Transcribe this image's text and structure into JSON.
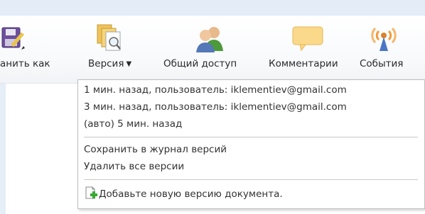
{
  "toolbar": {
    "buttons": [
      {
        "label": "анить как",
        "icon": "save-as-icon"
      },
      {
        "label": "Версия",
        "caret": "▼",
        "icon": "version-icon"
      },
      {
        "label": "Общий доступ",
        "icon": "sharing-icon"
      },
      {
        "label": "Комментарии",
        "icon": "comments-icon"
      },
      {
        "label": "События",
        "icon": "events-icon"
      }
    ]
  },
  "version_menu": {
    "versions": [
      {
        "label": "1 мин. назад, пользователь: iklementiev@gmail.com"
      },
      {
        "label": "3 мин. назад, пользователь: iklementiev@gmail.com"
      },
      {
        "label": "(авто) 5 мин. назад"
      }
    ],
    "actions": {
      "save_to_journal": "Сохранить в журнал версий",
      "delete_all": "Удалить все версии"
    },
    "add_new_version": {
      "label": "Добавьте новую версию документа.",
      "icon": "add-document-icon"
    }
  },
  "colors": {
    "top_stripe": "#e3ecf7",
    "menu_border": "#bfbfbf",
    "add_icon_green": "#3aa935",
    "comment_bubble": "#fbd98a",
    "events_orange": "#f39a3a"
  }
}
